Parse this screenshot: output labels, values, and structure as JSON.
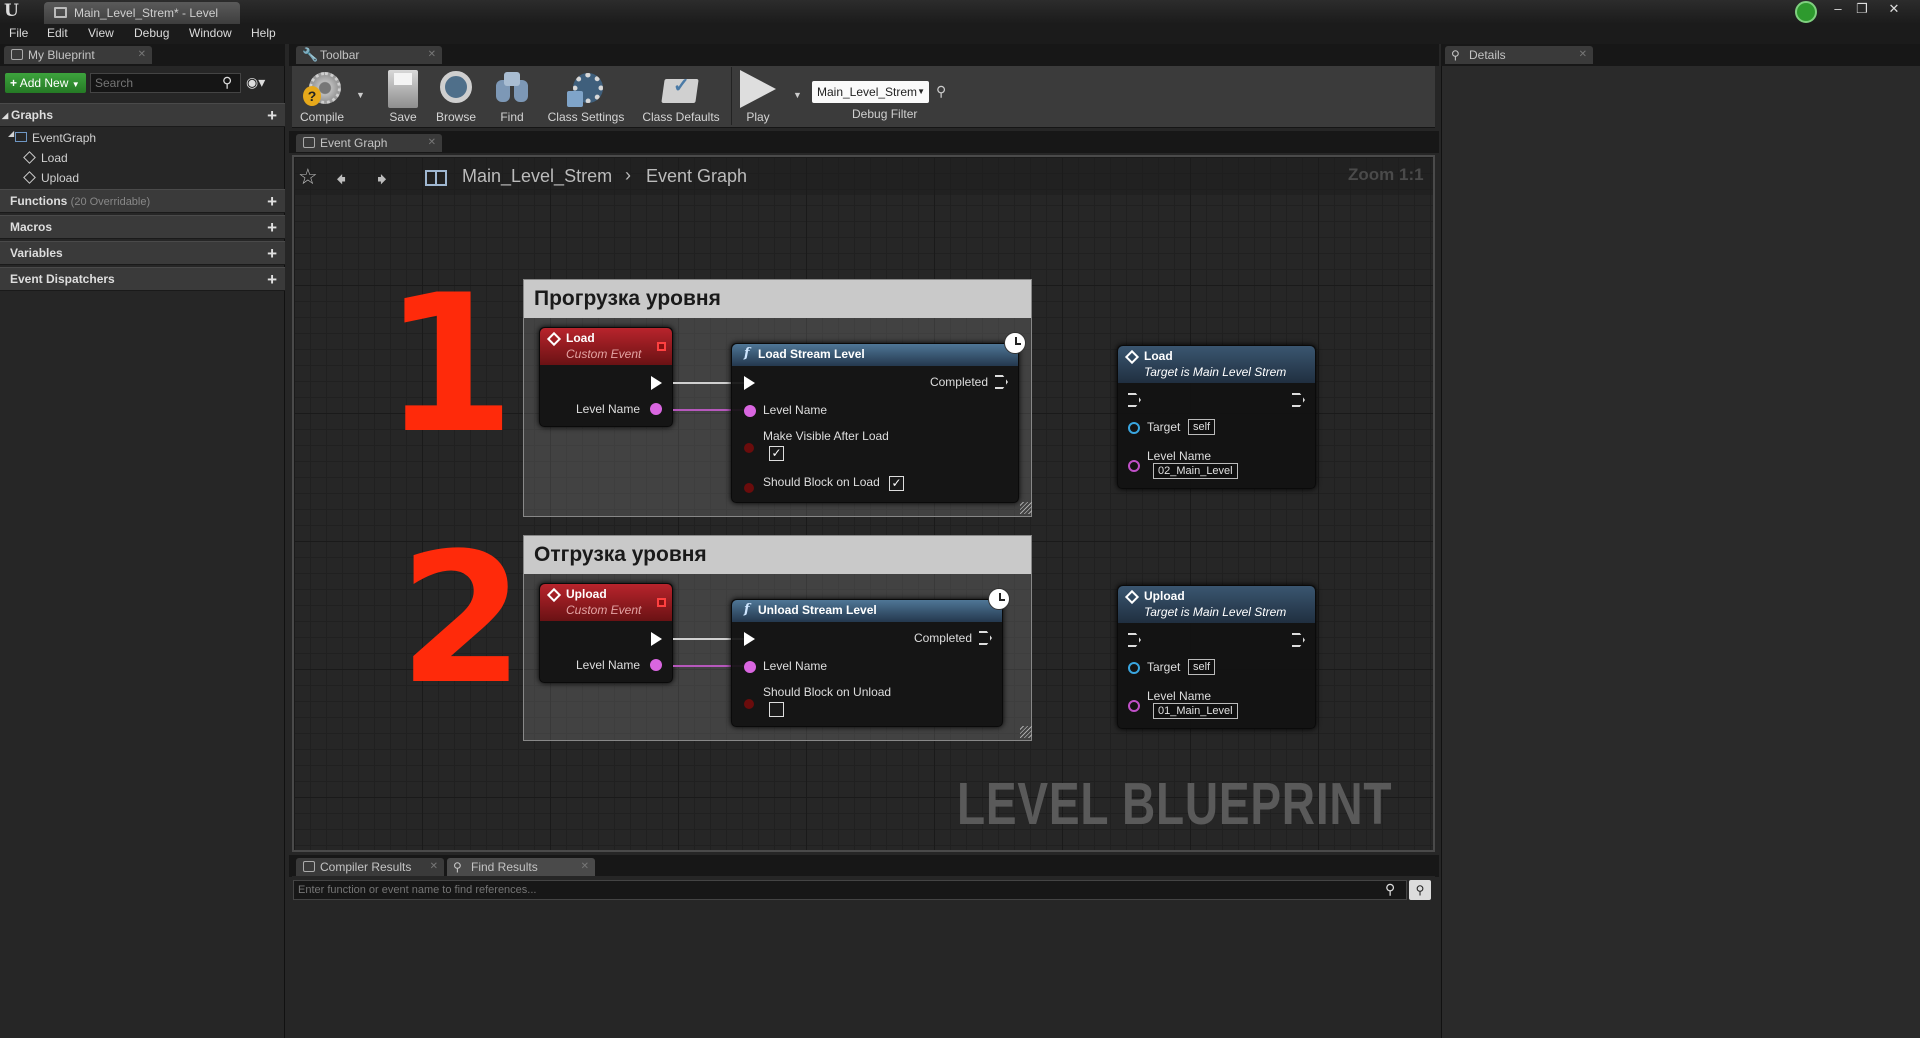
{
  "window": {
    "tab_title": "Main_Level_Strem* - Level"
  },
  "menu": [
    "File",
    "Edit",
    "View",
    "Debug",
    "Window",
    "Help"
  ],
  "my_blueprint": {
    "tab": "My Blueprint",
    "add_new": "Add New",
    "search_placeholder": "Search",
    "graphs_header": "Graphs",
    "event_graph": "EventGraph",
    "events": [
      "Load",
      "Upload"
    ],
    "functions_header": "Functions",
    "functions_note": "(20 Overridable)",
    "macros_header": "Macros",
    "variables_header": "Variables",
    "dispatchers_header": "Event Dispatchers"
  },
  "toolbar": {
    "tab": "Toolbar",
    "compile": "Compile",
    "save": "Save",
    "browse": "Browse",
    "find": "Find",
    "class_settings": "Class Settings",
    "class_defaults": "Class Defaults",
    "play": "Play",
    "debug_select": "Main_Level_Strem",
    "debug_filter": "Debug Filter"
  },
  "details": {
    "tab": "Details"
  },
  "graph": {
    "tab": "Event Graph",
    "breadcrumb_root": "Main_Level_Strem",
    "breadcrumb_leaf": "Event Graph",
    "zoom": "Zoom 1:1",
    "watermark": "LEVEL BLUEPRINT",
    "annotation_1": "1",
    "annotation_2": "2",
    "comment_1": "Прогрузка уровня",
    "comment_2": "Отгрузка уровня",
    "load_event": {
      "title": "Load",
      "subtitle": "Custom Event",
      "pin": "Level Name"
    },
    "load_stream": {
      "title": "Load Stream Level",
      "completed": "Completed",
      "level_name": "Level Name",
      "make_visible": "Make Visible After Load",
      "should_block": "Should Block on Load",
      "make_visible_checked": true,
      "should_block_checked": true
    },
    "load_call": {
      "title": "Load",
      "subtitle": "Target is Main Level Strem",
      "target": "Target",
      "target_value": "self",
      "level_name": "Level Name",
      "level_value": "02_Main_Level"
    },
    "upload_event": {
      "title": "Upload",
      "subtitle": "Custom Event",
      "pin": "Level Name"
    },
    "unload_stream": {
      "title": "Unload Stream Level",
      "completed": "Completed",
      "level_name": "Level Name",
      "should_block": "Should Block on Unload",
      "should_block_checked": false
    },
    "upload_call": {
      "title": "Upload",
      "subtitle": "Target is Main Level Strem",
      "target": "Target",
      "target_value": "self",
      "level_name": "Level Name",
      "level_value": "01_Main_Level"
    }
  },
  "bottom": {
    "compiler_tab": "Compiler Results",
    "find_tab": "Find Results",
    "find_placeholder": "Enter function or event name to find references..."
  },
  "colors": {
    "accent_green": "#2e9a2e",
    "event_red": "#b8242c",
    "function_blue": "#4f7696",
    "annotation": "#ff2a0a"
  }
}
